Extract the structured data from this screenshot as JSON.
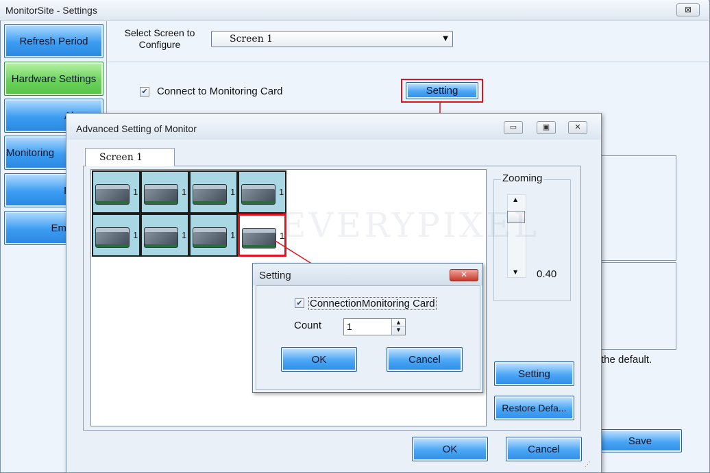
{
  "window": {
    "title": "MonitorSite - Settings",
    "close_glyph": "⊠"
  },
  "nav": {
    "items": [
      {
        "label": "Refresh Period"
      },
      {
        "label": "Hardware Settings"
      },
      {
        "label": "Alarm"
      },
      {
        "label": "Monitoring"
      },
      {
        "label": "Ema"
      },
      {
        "label": "Email L"
      }
    ]
  },
  "screen_select": {
    "label": "Select Screen to Configure",
    "value": "Screen  1"
  },
  "monitoring_card": {
    "checkbox_label": "Connect to Monitoring Card",
    "checked": true,
    "setting_label": "Setting"
  },
  "main_hint": "the default.",
  "main_save_label": "Save",
  "advanced_dialog": {
    "title": "Advanced Setting of Monitor",
    "tab_label": "Screen  1",
    "cards": [
      "1",
      "1",
      "1",
      "1",
      "1",
      "1",
      "1",
      "1"
    ],
    "zoom": {
      "label": "Zooming",
      "value": "0.40"
    },
    "setting_label": "Setting",
    "restore_label": "Restore Defa...",
    "ok_label": "OK",
    "cancel_label": "Cancel"
  },
  "setting_dialog": {
    "title": "Setting",
    "checkbox_label": "ConnectionMonitoring Card",
    "checked": true,
    "count_label": "Count",
    "count_value": "1",
    "ok_label": "OK",
    "cancel_label": "Cancel"
  },
  "watermark": "EVERYPIXEL",
  "colors": {
    "accent_blue": "#3b9cf1",
    "active_green": "#6cd35a",
    "highlight_red": "#e0121a",
    "card_cell": "#a9d8e4"
  }
}
